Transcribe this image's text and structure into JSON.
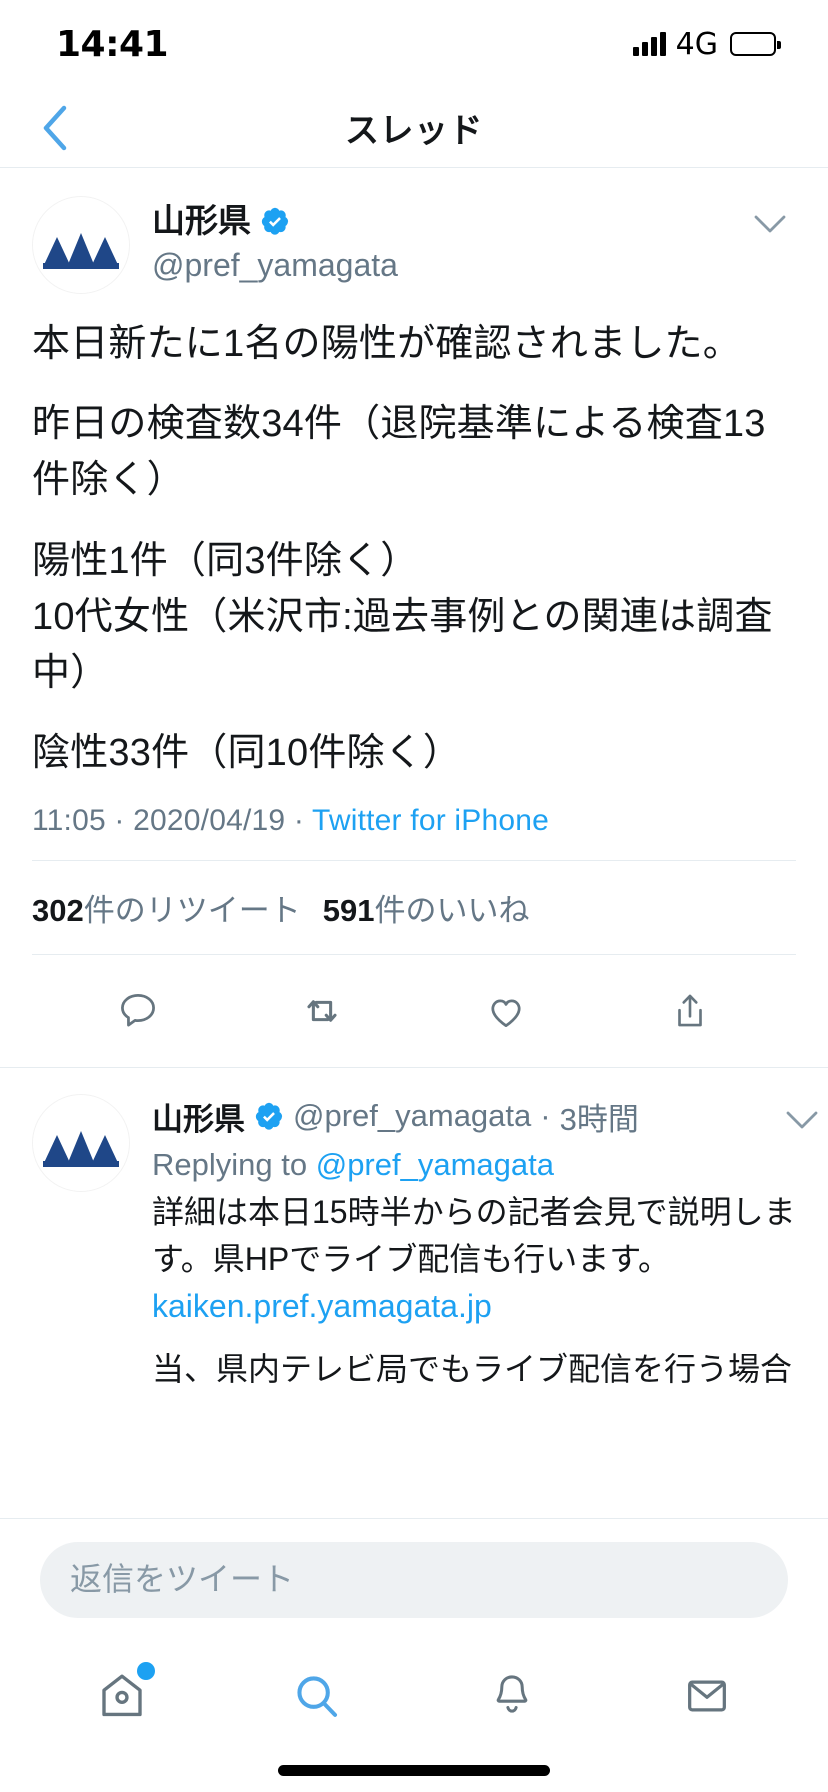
{
  "status_bar": {
    "time": "14:41",
    "network": "4G",
    "signal_icon": "signal-bars-icon",
    "battery_icon": "battery-icon"
  },
  "nav": {
    "back_icon": "chevron-left-icon",
    "title": "スレッド"
  },
  "main_tweet": {
    "avatar_icon": "yamagata-mountains-avatar",
    "display_name": "山形県",
    "verified_icon": "verified-badge-icon",
    "handle": "@pref_yamagata",
    "caret_icon": "chevron-down-icon",
    "paragraphs": [
      "本日新たに1名の陽性が確認されました。",
      "昨日の検査数34件（退院基準による検査13件除く）",
      "陽性1件（同3件除く）\n10代女性（米沢市:過去事例との関連は調査中）",
      "陰性33件（同10件除く）"
    ],
    "meta": {
      "time": "11:05",
      "sep1": " · ",
      "date": "2020/04/19",
      "sep2": " · ",
      "source": "Twitter for iPhone"
    },
    "stats": {
      "retweet_count": "302",
      "retweet_label": "件のリツイート",
      "like_count": "591",
      "like_label": "件のいいね"
    },
    "actions": [
      {
        "name": "reply-icon"
      },
      {
        "name": "retweet-icon"
      },
      {
        "name": "like-icon"
      },
      {
        "name": "share-icon"
      }
    ]
  },
  "reply_tweet": {
    "avatar_icon": "yamagata-mountains-avatar",
    "display_name": "山形県",
    "verified_icon": "verified-badge-icon",
    "handle": "@pref_yamagata",
    "time_sep": " · ",
    "time": "3時間",
    "caret_icon": "chevron-down-icon",
    "replying_to_prefix": "Replying to ",
    "replying_to_handle": "@pref_yamagata",
    "body": "詳細は本日15時半からの記者会見で説明します。県HPでライブ配信も行います。",
    "link": "kaiken.pref.yamagata.jp",
    "clipped_text": "当、県内テレビ局でもライブ配信を行う場合"
  },
  "compose": {
    "placeholder": "返信をツイート"
  },
  "tab_bar": {
    "items": [
      {
        "name": "home-icon",
        "active": false,
        "badge": true
      },
      {
        "name": "search-icon",
        "active": true,
        "badge": false
      },
      {
        "name": "notifications-bell-icon",
        "active": false,
        "badge": false
      },
      {
        "name": "messages-envelope-icon",
        "active": false,
        "badge": false
      }
    ]
  },
  "colors": {
    "accent": "#1da1f2",
    "text": "#14171a",
    "muted": "#657786",
    "divider": "#e6ecf0",
    "avatar_logo": "#1f4788",
    "compose_bg": "#eef1f3"
  }
}
